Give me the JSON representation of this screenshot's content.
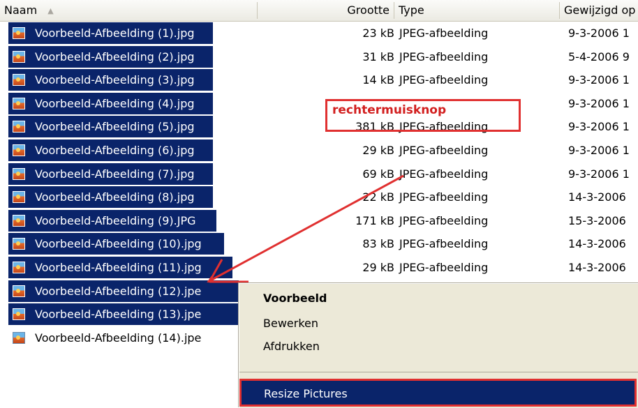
{
  "columns": {
    "name": "Naam",
    "size": "Grootte",
    "type": "Type",
    "modified": "Gewijzigd op"
  },
  "files": [
    {
      "name": "Voorbeeld-Afbeelding (1).jpg",
      "size": "23 kB",
      "type": "JPEG-afbeelding",
      "date": "9-3-2006 1",
      "selected": true
    },
    {
      "name": "Voorbeeld-Afbeelding (2).jpg",
      "size": "31 kB",
      "type": "JPEG-afbeelding",
      "date": "5-4-2006 9",
      "selected": true
    },
    {
      "name": "Voorbeeld-Afbeelding (3).jpg",
      "size": "14 kB",
      "type": "JPEG-afbeelding",
      "date": "9-3-2006 1",
      "selected": true
    },
    {
      "name": "Voorbeeld-Afbeelding (4).jpg",
      "size": "",
      "type": "",
      "date": "9-3-2006 1",
      "selected": true
    },
    {
      "name": "Voorbeeld-Afbeelding (5).jpg",
      "size": "381 kB",
      "type": "JPEG-afbeelding",
      "date": "9-3-2006 1",
      "selected": true
    },
    {
      "name": "Voorbeeld-Afbeelding (6).jpg",
      "size": "29 kB",
      "type": "JPEG-afbeelding",
      "date": "9-3-2006 1",
      "selected": true
    },
    {
      "name": "Voorbeeld-Afbeelding (7).jpg",
      "size": "69 kB",
      "type": "JPEG-afbeelding",
      "date": "9-3-2006 1",
      "selected": true
    },
    {
      "name": "Voorbeeld-Afbeelding (8).jpg",
      "size": "22 kB",
      "type": "JPEG-afbeelding",
      "date": "14-3-2006",
      "selected": true
    },
    {
      "name": "Voorbeeld-Afbeelding (9).JPG",
      "size": "171 kB",
      "type": "JPEG-afbeelding",
      "date": "15-3-2006",
      "selected": true
    },
    {
      "name": "Voorbeeld-Afbeelding (10).jpg",
      "size": "83 kB",
      "type": "JPEG-afbeelding",
      "date": "14-3-2006",
      "selected": true
    },
    {
      "name": "Voorbeeld-Afbeelding (11).jpg",
      "size": "29 kB",
      "type": "JPEG-afbeelding",
      "date": "14-3-2006",
      "selected": true
    },
    {
      "name": "Voorbeeld-Afbeelding (12).jpe",
      "size": "",
      "type": "",
      "date": "",
      "selected": true
    },
    {
      "name": "Voorbeeld-Afbeelding (13).jpe",
      "size": "",
      "type": "",
      "date": "",
      "selected": true
    },
    {
      "name": "Voorbeeld-Afbeelding (14).jpe",
      "size": "",
      "type": "",
      "date": "",
      "selected": false
    }
  ],
  "annotation": {
    "label": "rechtermuisknop",
    "color": "#e03030"
  },
  "context_menu": {
    "items": [
      "Voorbeeld",
      "Bewerken",
      "Afdrukken"
    ],
    "highlighted": "Resize Pictures"
  },
  "colors": {
    "selection": "#0a246a",
    "menu_bg": "#ece9d8"
  },
  "icons": {
    "file": "jpeg-image-icon",
    "sort": "sort-ascending-icon"
  }
}
